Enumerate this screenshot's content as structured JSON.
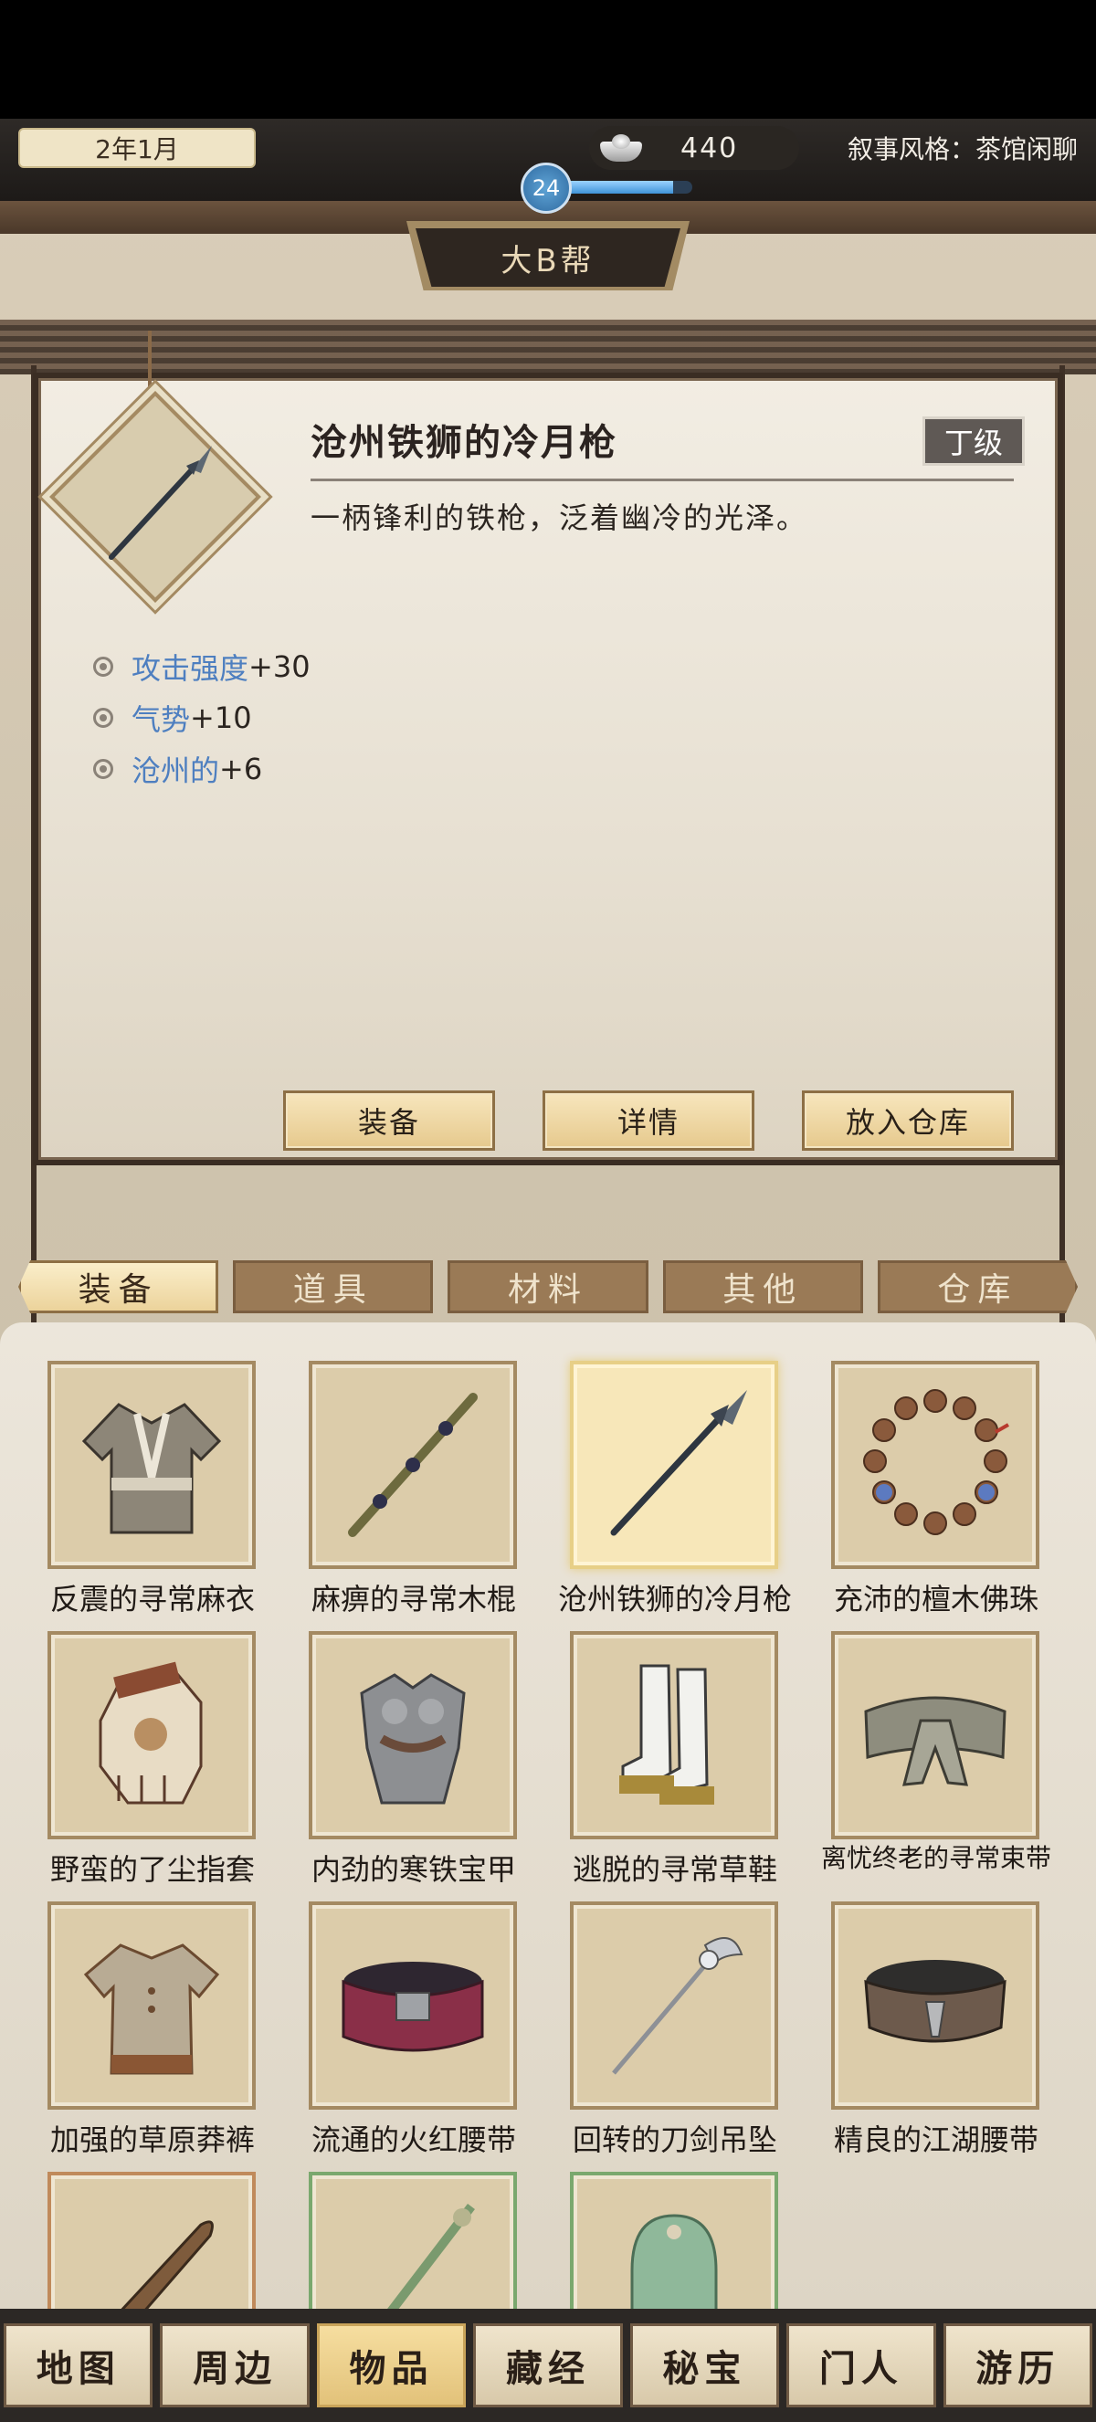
{
  "header": {
    "date": "2年1月",
    "silver": "440",
    "narrative": "叙事风格：茶馆闲聊",
    "level": "24",
    "guild": "大B帮"
  },
  "detail": {
    "name": "沧州铁狮的冷月枪",
    "grade": "丁级",
    "description": "一柄锋利的铁枪，泛着幽冷的光泽。",
    "stats": [
      {
        "name": "攻击强度",
        "value": "+30"
      },
      {
        "name": "气势",
        "value": "+10"
      },
      {
        "name": "沧州的",
        "value": "+6"
      }
    ],
    "buttons": {
      "equip": "装备",
      "details": "详情",
      "store": "放入仓库"
    }
  },
  "tabs": [
    "装备",
    "道具",
    "材料",
    "其他",
    "仓库"
  ],
  "items": [
    {
      "label": "反震的寻常麻衣",
      "icon": "robe-icon"
    },
    {
      "label": "麻痹的寻常木棍",
      "icon": "staff-icon"
    },
    {
      "label": "沧州铁狮的冷月枪",
      "icon": "spear-icon"
    },
    {
      "label": "充沛的檀木佛珠",
      "icon": "beads-icon"
    },
    {
      "label": "野蛮的了尘指套",
      "icon": "glove-icon"
    },
    {
      "label": "内劲的寒铁宝甲",
      "icon": "armor-icon"
    },
    {
      "label": "逃脱的寻常草鞋",
      "icon": "boots-icon"
    },
    {
      "label": "离忧终老的寻常束带",
      "icon": "sash-icon"
    },
    {
      "label": "加强的草原莽裤",
      "icon": "tunic-icon"
    },
    {
      "label": "流通的火红腰带",
      "icon": "belt-red-icon"
    },
    {
      "label": "回转的刀剑吊坠",
      "icon": "pendant-icon"
    },
    {
      "label": "精良的江湖腰带",
      "icon": "belt-dark-icon"
    },
    {
      "label": "",
      "icon": "saber-icon"
    },
    {
      "label": "",
      "icon": "sword-icon"
    },
    {
      "label": "",
      "icon": "jade-icon"
    }
  ],
  "nav": [
    "地图",
    "周边",
    "物品",
    "藏经",
    "秘宝",
    "门人",
    "游历"
  ]
}
